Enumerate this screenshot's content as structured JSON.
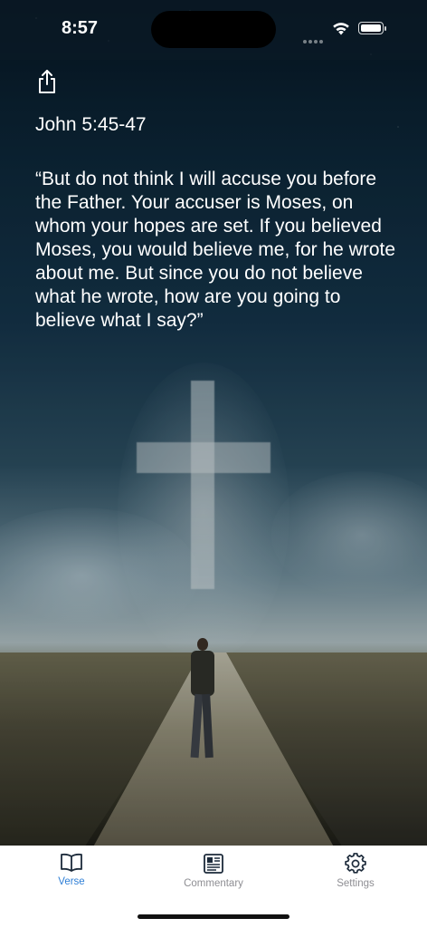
{
  "status_bar": {
    "time": "8:57",
    "wifi_icon": "wifi-icon",
    "battery_icon": "battery-icon"
  },
  "verse": {
    "share_icon": "share-icon",
    "reference": "John 5:45-47",
    "text": "“But do not think I will accuse you before the Father. Your accuser is Moses, on whom your hopes are set.  If you believed Moses, you would believe me, for he wrote about me.  But since you do not believe what he wrote, how are you going to believe what I say?”"
  },
  "tabs": [
    {
      "label": "Verse",
      "icon": "book-icon",
      "active": true
    },
    {
      "label": "Commentary",
      "icon": "newspaper-icon",
      "active": false
    },
    {
      "label": "Settings",
      "icon": "gear-icon",
      "active": false
    }
  ],
  "colors": {
    "accent": "#2f7fd6",
    "tab_inactive": "#8e8e93",
    "text": "#ffffff"
  }
}
